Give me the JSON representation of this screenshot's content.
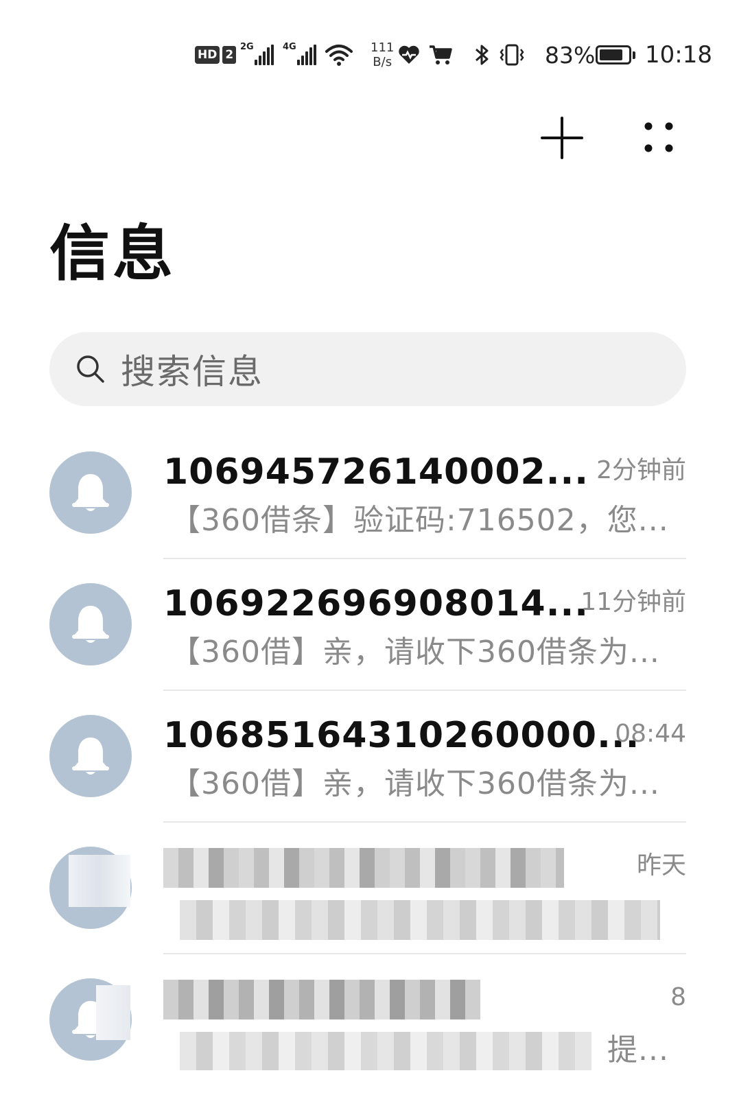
{
  "status_bar": {
    "hd": "HD",
    "sim": "2",
    "net1": "2G",
    "net2": "4G",
    "speed_value": "111",
    "speed_unit": "B/s",
    "battery_percent": "83%",
    "battery_level": 0.83,
    "time": "10:18",
    "icons": [
      "hd-icon",
      "sim2-icon",
      "signal-2g-icon",
      "signal-4g-icon",
      "wifi-icon",
      "health-icon",
      "shopping-cart-icon",
      "bluetooth-icon",
      "vibrate-icon",
      "battery-icon"
    ]
  },
  "header": {
    "add_icon": "plus-icon",
    "more_icon": "more-dots-icon",
    "title": "信息"
  },
  "search": {
    "placeholder": "搜索信息",
    "icon": "search-icon"
  },
  "conversations": [
    {
      "sender": "106945726140002...",
      "time": "2分钟前",
      "preview": "【360借条】验证码:716502，您...",
      "blurred": false
    },
    {
      "sender": "106922696908014...",
      "time": "11分钟前",
      "preview": "【360借】亲，请收下360借条为...",
      "blurred": false
    },
    {
      "sender": "10685164310260000...",
      "time": "08:44",
      "preview": "【360借】亲，请收下360借条为...",
      "blurred": false
    },
    {
      "sender": "",
      "time": "昨天",
      "preview": "",
      "blurred": true
    },
    {
      "sender": "",
      "time": "8",
      "preview": "提...",
      "blurred": true
    }
  ],
  "colors": {
    "avatar_bg": "#b4c3d4",
    "search_bg": "#f1f1f1",
    "secondary_text": "#8a8a8a"
  }
}
